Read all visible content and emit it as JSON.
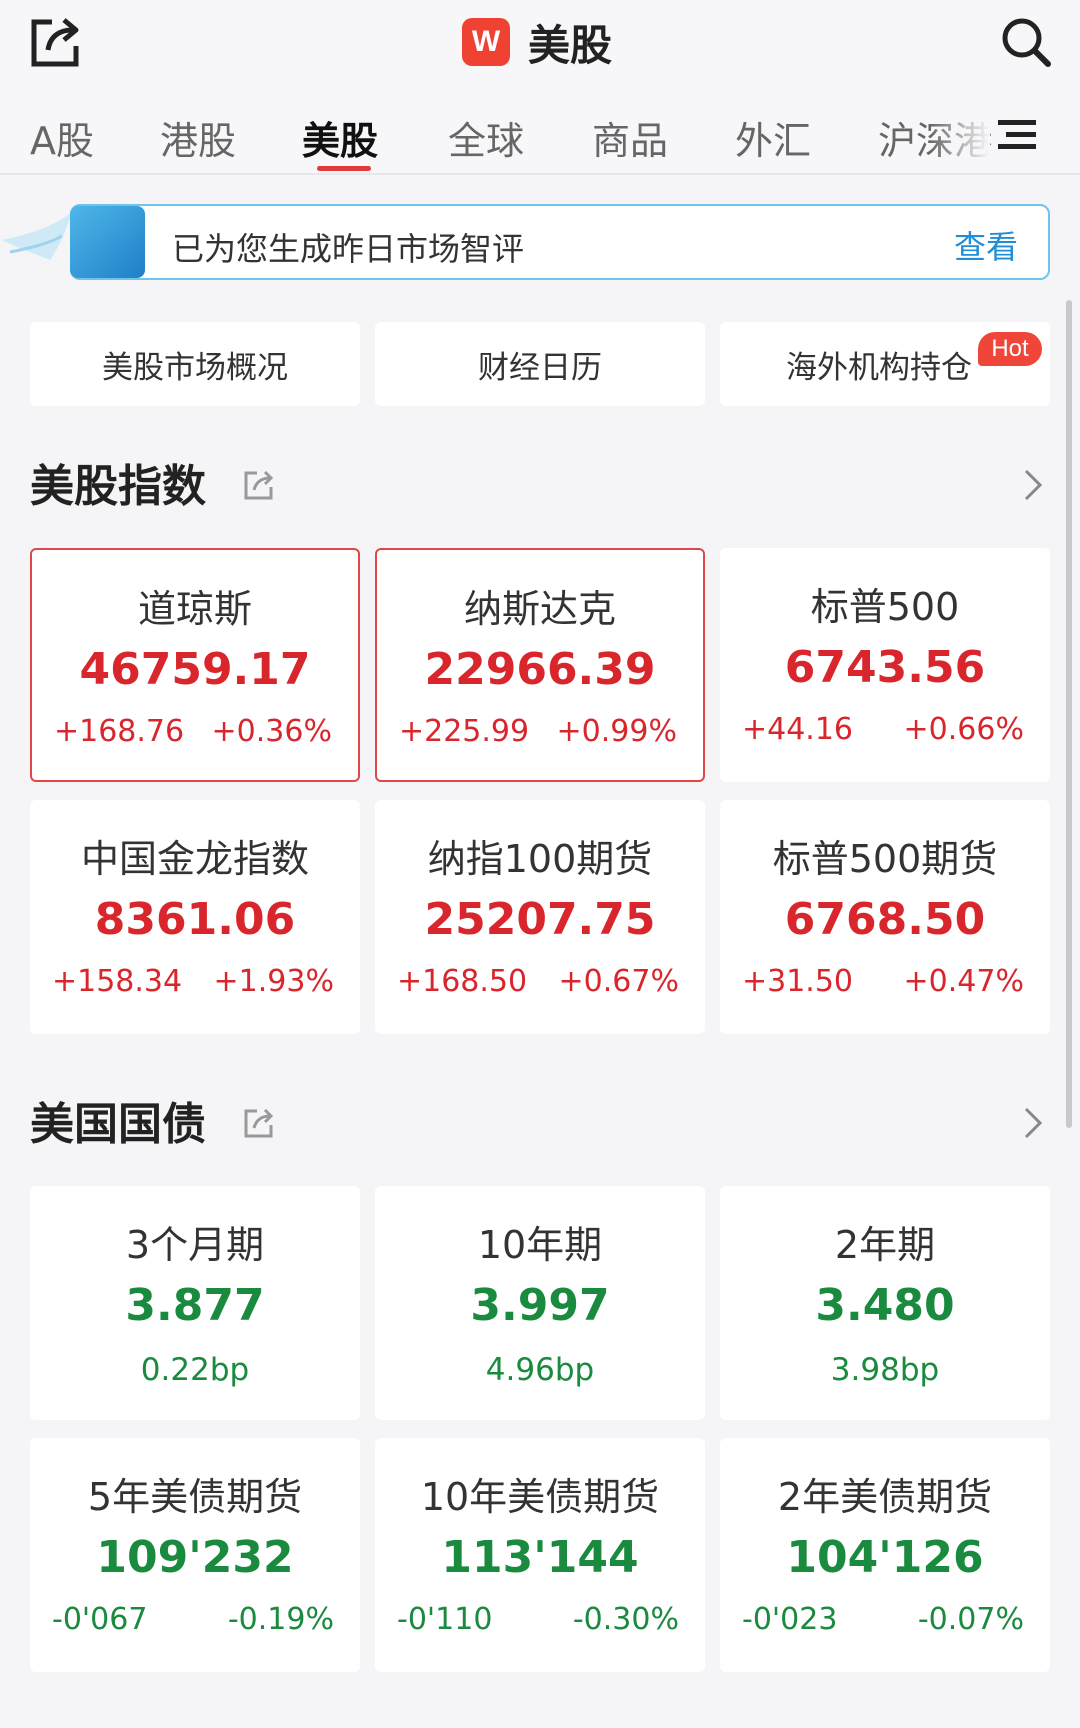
{
  "header": {
    "title": "美股",
    "logo_text": "W",
    "icons": [
      "share-icon",
      "search-icon",
      "menu-icon"
    ],
    "accent_color": "#ef4233"
  },
  "tabs": [
    {
      "label": "A股",
      "active": false
    },
    {
      "label": "港股",
      "active": false
    },
    {
      "label": "美股",
      "active": true
    },
    {
      "label": "全球",
      "active": false
    },
    {
      "label": "商品",
      "active": false
    },
    {
      "label": "外汇",
      "active": false
    },
    {
      "label": "沪深港",
      "active": false
    }
  ],
  "banner": {
    "text": "已为您生成昨日市场智评",
    "link": "查看"
  },
  "quick_buttons": [
    {
      "label": "美股市场概况"
    },
    {
      "label": "财经日历"
    },
    {
      "label": "海外机构持仓",
      "badge": "Hot"
    }
  ],
  "indices": {
    "title": "美股指数",
    "cards": [
      {
        "name": "道琼斯",
        "value": "46759.17",
        "change": "+168.76",
        "pct": "+0.36%",
        "highlighted": true
      },
      {
        "name": "纳斯达克",
        "value": "22966.39",
        "change": "+225.99",
        "pct": "+0.99%",
        "highlighted": true
      },
      {
        "name": "标普500",
        "value": "6743.56",
        "change": "+44.16",
        "pct": "+0.66%",
        "highlighted": false
      },
      {
        "name": "中国金龙指数",
        "value": "8361.06",
        "change": "+158.34",
        "pct": "+1.93%",
        "highlighted": false
      },
      {
        "name": "纳指100期货",
        "value": "25207.75",
        "change": "+168.50",
        "pct": "+0.67%",
        "highlighted": false
      },
      {
        "name": "标普500期货",
        "value": "6768.50",
        "change": "+31.50",
        "pct": "+0.47%",
        "highlighted": false
      }
    ]
  },
  "treasuries": {
    "title": "美国国债",
    "yields": [
      {
        "name": "3个月期",
        "value": "3.877",
        "bp": "0.22bp"
      },
      {
        "name": "10年期",
        "value": "3.997",
        "bp": "4.96bp"
      },
      {
        "name": "2年期",
        "value": "3.480",
        "bp": "3.98bp"
      }
    ],
    "futures": [
      {
        "name": "5年美债期货",
        "value": "109'232",
        "change": "-0'067",
        "pct": "-0.19%"
      },
      {
        "name": "10年美债期货",
        "value": "113'144",
        "change": "-0'110",
        "pct": "-0.30%"
      },
      {
        "name": "2年美债期货",
        "value": "104'126",
        "change": "-0'023",
        "pct": "-0.07%"
      }
    ]
  },
  "colors": {
    "up": "#d9262c",
    "down": "#1a8a3e",
    "link": "#1f8ed6"
  }
}
